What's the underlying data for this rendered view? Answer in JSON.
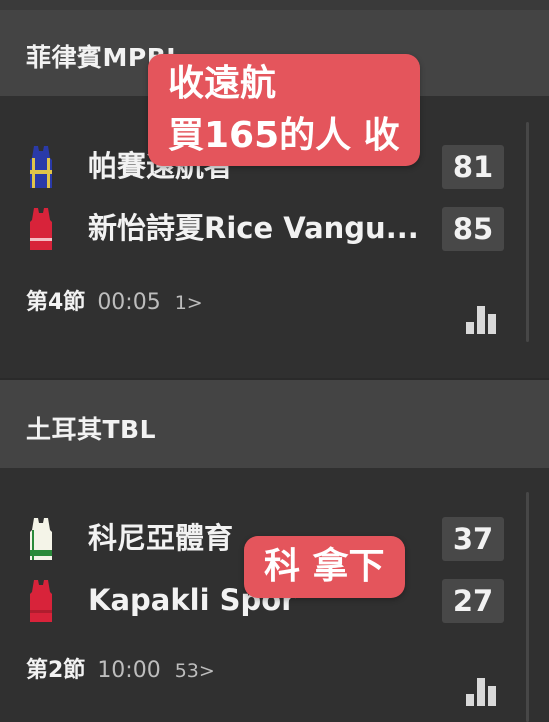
{
  "leagues": [
    {
      "title": "菲律賓MPBL",
      "teams": [
        {
          "name": "帕賽遠航者",
          "score": "81",
          "jersey_color": "#2a3aa8",
          "jersey_trim": "#e0c44a"
        },
        {
          "name": "新怡詩夏Rice Vangu...",
          "score": "85",
          "jersey_color": "#d8233a",
          "jersey_trim": "#ffffff"
        }
      ],
      "period": "第4節",
      "time": "00:05",
      "count": "1>",
      "stats_icon": "bar-chart-icon"
    },
    {
      "title": "土耳其TBL",
      "teams": [
        {
          "name": "科尼亞體育",
          "score": "37",
          "jersey_color": "#f4f4e8",
          "jersey_trim": "#2a8a3a"
        },
        {
          "name": "Kapakli Spor",
          "score": "27",
          "jersey_color": "#d8233a",
          "jersey_trim": "#b01d2e"
        }
      ],
      "period": "第2節",
      "time": "10:00",
      "count": "53>",
      "stats_icon": "bar-chart-icon"
    }
  ],
  "overlays": {
    "first": {
      "line1": "收遠航",
      "line2": "買165的人 收"
    },
    "second": {
      "line1": "科 拿下"
    }
  },
  "colors": {
    "background": "#2f2f2f",
    "header": "#444444",
    "score_box": "#484848",
    "overlay": "#e4555c"
  }
}
